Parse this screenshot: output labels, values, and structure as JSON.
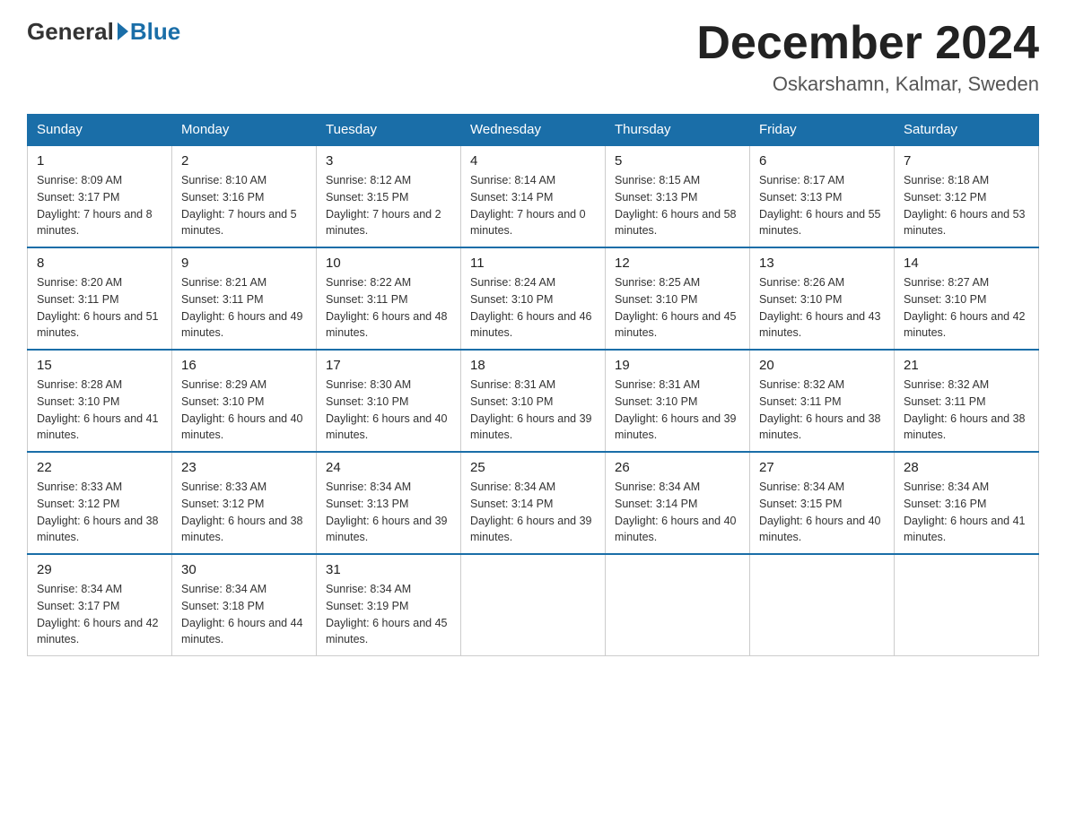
{
  "header": {
    "logo_general": "General",
    "logo_blue": "Blue",
    "month_title": "December 2024",
    "location": "Oskarshamn, Kalmar, Sweden"
  },
  "calendar": {
    "days_of_week": [
      "Sunday",
      "Monday",
      "Tuesday",
      "Wednesday",
      "Thursday",
      "Friday",
      "Saturday"
    ],
    "weeks": [
      [
        {
          "day": "1",
          "sunrise": "8:09 AM",
          "sunset": "3:17 PM",
          "daylight": "7 hours and 8 minutes."
        },
        {
          "day": "2",
          "sunrise": "8:10 AM",
          "sunset": "3:16 PM",
          "daylight": "7 hours and 5 minutes."
        },
        {
          "day": "3",
          "sunrise": "8:12 AM",
          "sunset": "3:15 PM",
          "daylight": "7 hours and 2 minutes."
        },
        {
          "day": "4",
          "sunrise": "8:14 AM",
          "sunset": "3:14 PM",
          "daylight": "7 hours and 0 minutes."
        },
        {
          "day": "5",
          "sunrise": "8:15 AM",
          "sunset": "3:13 PM",
          "daylight": "6 hours and 58 minutes."
        },
        {
          "day": "6",
          "sunrise": "8:17 AM",
          "sunset": "3:13 PM",
          "daylight": "6 hours and 55 minutes."
        },
        {
          "day": "7",
          "sunrise": "8:18 AM",
          "sunset": "3:12 PM",
          "daylight": "6 hours and 53 minutes."
        }
      ],
      [
        {
          "day": "8",
          "sunrise": "8:20 AM",
          "sunset": "3:11 PM",
          "daylight": "6 hours and 51 minutes."
        },
        {
          "day": "9",
          "sunrise": "8:21 AM",
          "sunset": "3:11 PM",
          "daylight": "6 hours and 49 minutes."
        },
        {
          "day": "10",
          "sunrise": "8:22 AM",
          "sunset": "3:11 PM",
          "daylight": "6 hours and 48 minutes."
        },
        {
          "day": "11",
          "sunrise": "8:24 AM",
          "sunset": "3:10 PM",
          "daylight": "6 hours and 46 minutes."
        },
        {
          "day": "12",
          "sunrise": "8:25 AM",
          "sunset": "3:10 PM",
          "daylight": "6 hours and 45 minutes."
        },
        {
          "day": "13",
          "sunrise": "8:26 AM",
          "sunset": "3:10 PM",
          "daylight": "6 hours and 43 minutes."
        },
        {
          "day": "14",
          "sunrise": "8:27 AM",
          "sunset": "3:10 PM",
          "daylight": "6 hours and 42 minutes."
        }
      ],
      [
        {
          "day": "15",
          "sunrise": "8:28 AM",
          "sunset": "3:10 PM",
          "daylight": "6 hours and 41 minutes."
        },
        {
          "day": "16",
          "sunrise": "8:29 AM",
          "sunset": "3:10 PM",
          "daylight": "6 hours and 40 minutes."
        },
        {
          "day": "17",
          "sunrise": "8:30 AM",
          "sunset": "3:10 PM",
          "daylight": "6 hours and 40 minutes."
        },
        {
          "day": "18",
          "sunrise": "8:31 AM",
          "sunset": "3:10 PM",
          "daylight": "6 hours and 39 minutes."
        },
        {
          "day": "19",
          "sunrise": "8:31 AM",
          "sunset": "3:10 PM",
          "daylight": "6 hours and 39 minutes."
        },
        {
          "day": "20",
          "sunrise": "8:32 AM",
          "sunset": "3:11 PM",
          "daylight": "6 hours and 38 minutes."
        },
        {
          "day": "21",
          "sunrise": "8:32 AM",
          "sunset": "3:11 PM",
          "daylight": "6 hours and 38 minutes."
        }
      ],
      [
        {
          "day": "22",
          "sunrise": "8:33 AM",
          "sunset": "3:12 PM",
          "daylight": "6 hours and 38 minutes."
        },
        {
          "day": "23",
          "sunrise": "8:33 AM",
          "sunset": "3:12 PM",
          "daylight": "6 hours and 38 minutes."
        },
        {
          "day": "24",
          "sunrise": "8:34 AM",
          "sunset": "3:13 PM",
          "daylight": "6 hours and 39 minutes."
        },
        {
          "day": "25",
          "sunrise": "8:34 AM",
          "sunset": "3:14 PM",
          "daylight": "6 hours and 39 minutes."
        },
        {
          "day": "26",
          "sunrise": "8:34 AM",
          "sunset": "3:14 PM",
          "daylight": "6 hours and 40 minutes."
        },
        {
          "day": "27",
          "sunrise": "8:34 AM",
          "sunset": "3:15 PM",
          "daylight": "6 hours and 40 minutes."
        },
        {
          "day": "28",
          "sunrise": "8:34 AM",
          "sunset": "3:16 PM",
          "daylight": "6 hours and 41 minutes."
        }
      ],
      [
        {
          "day": "29",
          "sunrise": "8:34 AM",
          "sunset": "3:17 PM",
          "daylight": "6 hours and 42 minutes."
        },
        {
          "day": "30",
          "sunrise": "8:34 AM",
          "sunset": "3:18 PM",
          "daylight": "6 hours and 44 minutes."
        },
        {
          "day": "31",
          "sunrise": "8:34 AM",
          "sunset": "3:19 PM",
          "daylight": "6 hours and 45 minutes."
        },
        null,
        null,
        null,
        null
      ]
    ]
  }
}
